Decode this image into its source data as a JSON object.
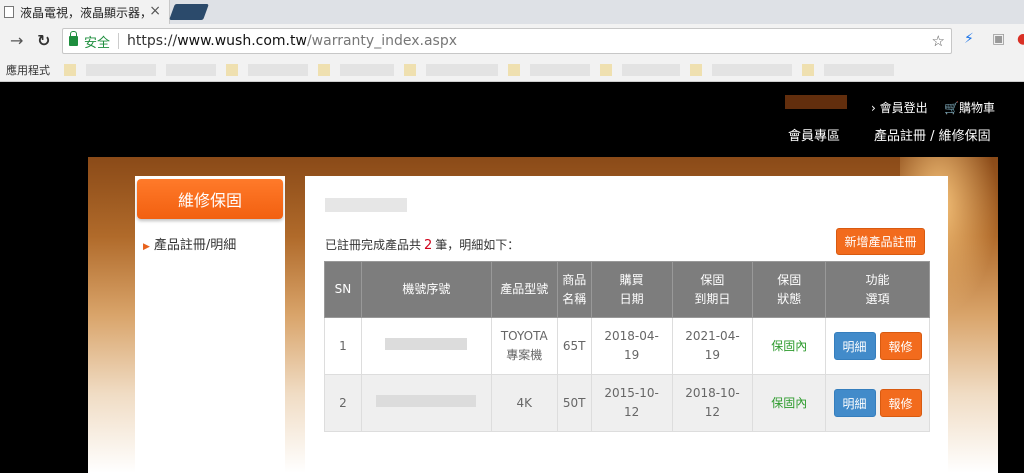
{
  "browser": {
    "tab_title": "液晶電視，液晶顯示器，",
    "secure_label": "安全",
    "url_scheme": "https://",
    "url_domain": "www.wush.com.tw",
    "url_path": "/warranty_index.aspx",
    "bookmarks_label": "應用程式"
  },
  "site": {
    "logout_label": "會員登出",
    "cart_label": "購物車",
    "nav_member": "會員專區",
    "nav_register": "產品註冊 / 維修保固"
  },
  "sidebar": {
    "header": "維修保固",
    "items": [
      {
        "label": "產品註冊/明細"
      }
    ]
  },
  "content": {
    "summary_prefix": "已註冊完成產品共",
    "summary_count": "2",
    "summary_suffix": "筆，明細如下：",
    "add_button": "新增產品註冊"
  },
  "table": {
    "headers": {
      "sn": "SN",
      "serial": "機號序號",
      "model": "產品型號",
      "name_1": "商品",
      "name_2": "名稱",
      "buy_1": "購買",
      "buy_2": "日期",
      "warranty_1": "保固",
      "warranty_2": "到期日",
      "status_1": "保固",
      "status_2": "狀態",
      "func_1": "功能",
      "func_2": "選項"
    },
    "rows": [
      {
        "sn": "1",
        "model_1": "TOYOTA",
        "model_2": "專案機",
        "name": "65T",
        "buy_1": "2018-04-",
        "buy_2": "19",
        "exp_1": "2021-04-",
        "exp_2": "19",
        "status": "保固內",
        "detail": "明細",
        "repair": "報修"
      },
      {
        "sn": "2",
        "model_1": "4K",
        "model_2": "",
        "name": "50T",
        "buy_1": "2015-10-",
        "buy_2": "12",
        "exp_1": "2018-10-",
        "exp_2": "12",
        "status": "保固內",
        "detail": "明細",
        "repair": "報修"
      }
    ]
  }
}
